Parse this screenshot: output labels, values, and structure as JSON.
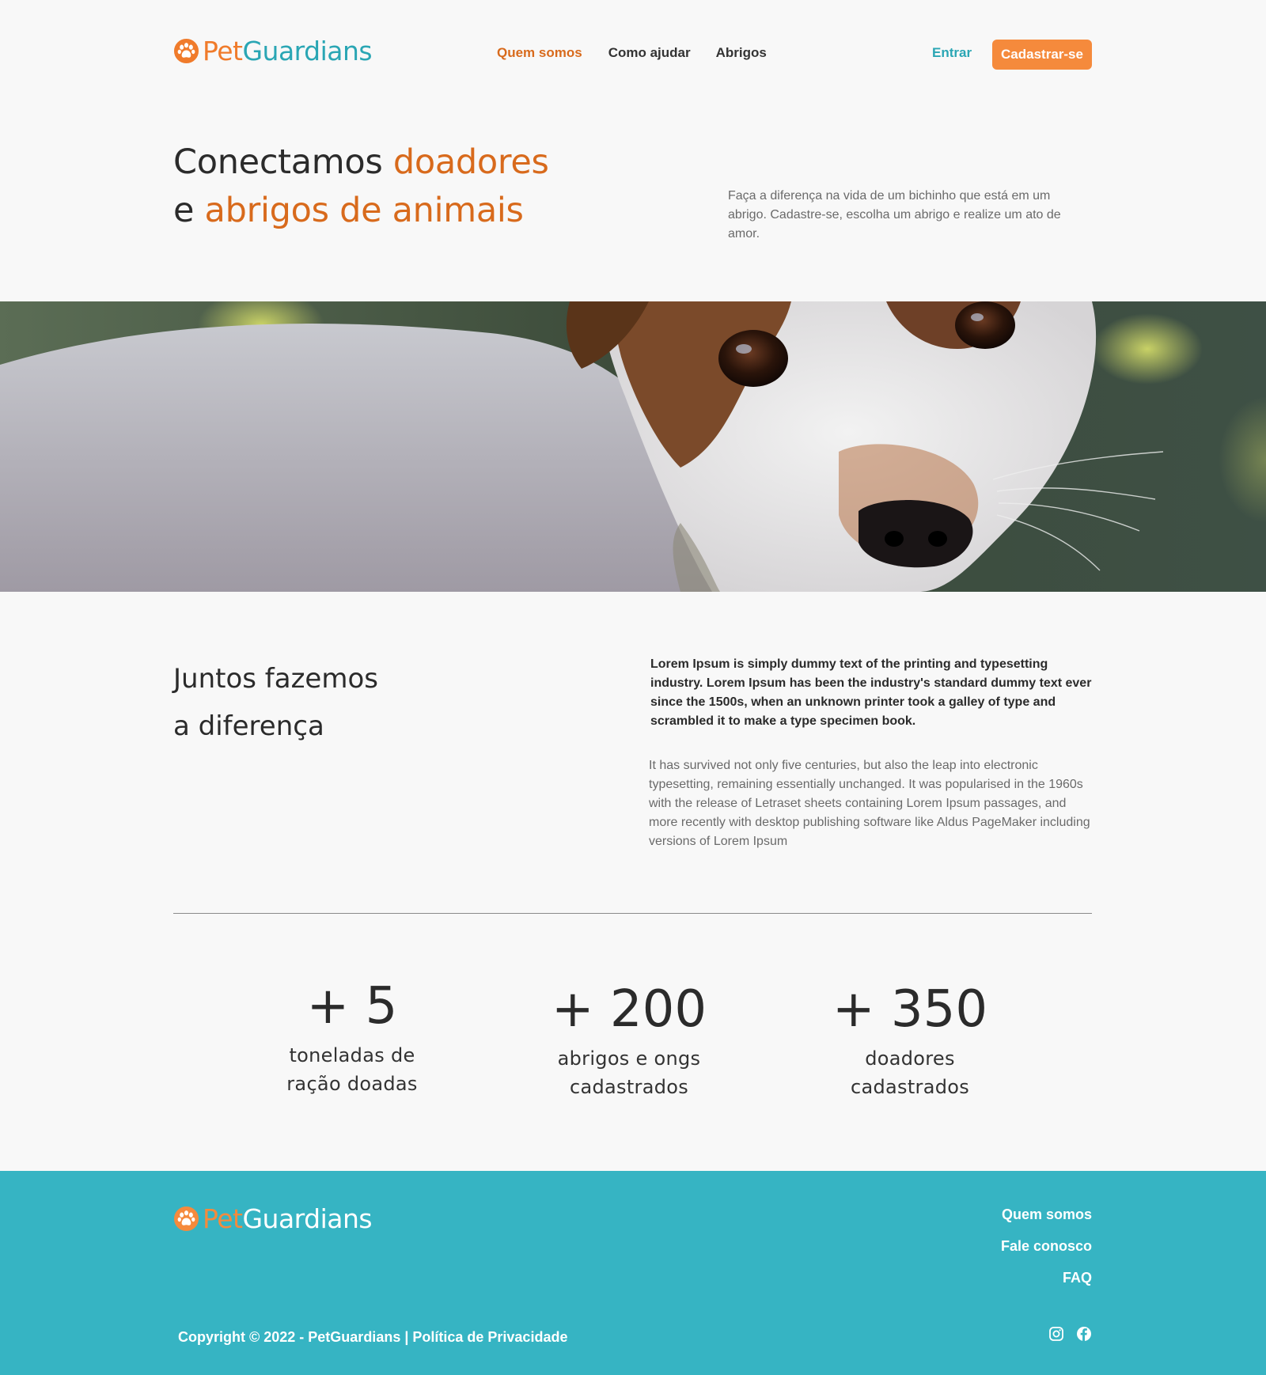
{
  "brand": {
    "pet": "Pet",
    "guardians": "Guardians"
  },
  "nav": {
    "items": [
      {
        "label": "Quem somos",
        "active": true
      },
      {
        "label": "Como ajudar",
        "active": false
      },
      {
        "label": "Abrigos",
        "active": false
      }
    ],
    "login": "Entrar",
    "signup": "Cadastrar-se"
  },
  "hero": {
    "line1_plain": "Conectamos ",
    "line1_accent": "doadores",
    "line2_plain": "e ",
    "line2_accent": "abrigos de animais",
    "description": "Faça a diferença na vida de um bichinho que está em um abrigo. Cadastre-se, escolha um abrigo e realize um ato de amor."
  },
  "about": {
    "title_line1": "Juntos fazemos",
    "title_line2": "a diferença",
    "lead": "Lorem Ipsum is simply dummy text of the printing and typesetting industry. Lorem Ipsum has been the industry's standard dummy text ever since the 1500s, when an unknown printer took a galley of type and scrambled it to make a type specimen book.",
    "body": "It has survived not only five centuries, but also the leap into electronic typesetting, remaining essentially unchanged. It was popularised in the 1960s with the release of Letraset sheets containing Lorem Ipsum passages, and more recently with desktop publishing software like Aldus PageMaker including versions of Lorem Ipsum"
  },
  "stats": [
    {
      "number": "+ 5",
      "label_line1": "toneladas de",
      "label_line2": "ração doadas"
    },
    {
      "number": "+ 200",
      "label_line1": "abrigos e ongs",
      "label_line2": "cadastrados"
    },
    {
      "number": "+ 350",
      "label_line1": "doadores",
      "label_line2": "cadastrados"
    }
  ],
  "footer": {
    "links": [
      "Quem somos",
      "Fale conosco",
      "FAQ"
    ],
    "copyright": "Copyright © 2022 - PetGuardians | ",
    "privacy": "Política de Privacidade",
    "social": [
      "instagram-icon",
      "facebook-icon"
    ]
  },
  "colors": {
    "accent_orange": "#d86a1c",
    "button_orange": "#f58a3c",
    "teal": "#2aa6b4",
    "footer_bg": "#36b4c3",
    "page_bg": "#f8f8f8"
  }
}
